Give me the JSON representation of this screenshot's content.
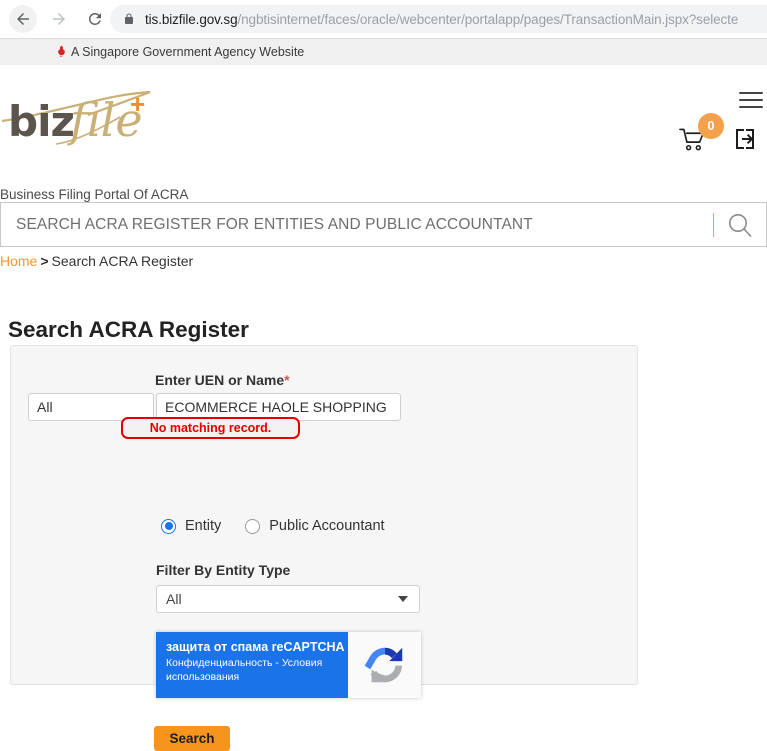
{
  "browser": {
    "url_host": "tis.bizfile.gov.sg",
    "url_path": "/ngbtisinternet/faces/oracle/webcenter/portalapp/pages/TransactionMain.jspx?selecte",
    "back_icon": "back-arrow-icon",
    "forward_icon": "forward-arrow-icon",
    "reload_icon": "reload-icon",
    "lock_icon": "lock-icon"
  },
  "gov_banner": {
    "text": "A Singapore Government Agency Website",
    "icon": "singapore-lion-icon"
  },
  "header": {
    "logo_biz": "biz",
    "logo_file": "file",
    "logo_plus": "+",
    "tagline": "Business Filing Portal Of ACRA",
    "cart_count": "0",
    "cart_icon": "shopping-cart-icon",
    "login_icon": "login-arrow-icon",
    "menu_icon": "hamburger-menu-icon",
    "accent_orange": "#f5a14b"
  },
  "site_search": {
    "placeholder": "SEARCH ACRA REGISTER FOR ENTITIES AND PUBLIC ACCOUNTANT",
    "value": "",
    "icon": "magnifier-icon",
    "divider_color": "#f2a33c"
  },
  "breadcrumb": {
    "home": "Home",
    "separator": ">",
    "current": "Search ACRA Register"
  },
  "main": {
    "page_title": "Search ACRA Register",
    "uen_label": "Enter UEN or Name",
    "uen_required_mark": "*",
    "uen_scope_value": "All",
    "uen_name_value": "ECOMMERCE HAOLE SHOPPING",
    "error_message": "No matching record.",
    "error_color": "#e50000",
    "radios": [
      {
        "label": "Entity",
        "checked": true
      },
      {
        "label": "Public Accountant",
        "checked": false
      }
    ],
    "filter_label": "Filter By Entity Type",
    "filter_value": "All",
    "recaptcha": {
      "title": "защита от спама reCAPTCHA",
      "terms": "Конфиденциальность - Условия использования",
      "logo_icon": "recaptcha-logo-icon",
      "brand_color": "#1a73e8"
    },
    "submit_label": "Search",
    "submit_color": "#f7941d"
  }
}
